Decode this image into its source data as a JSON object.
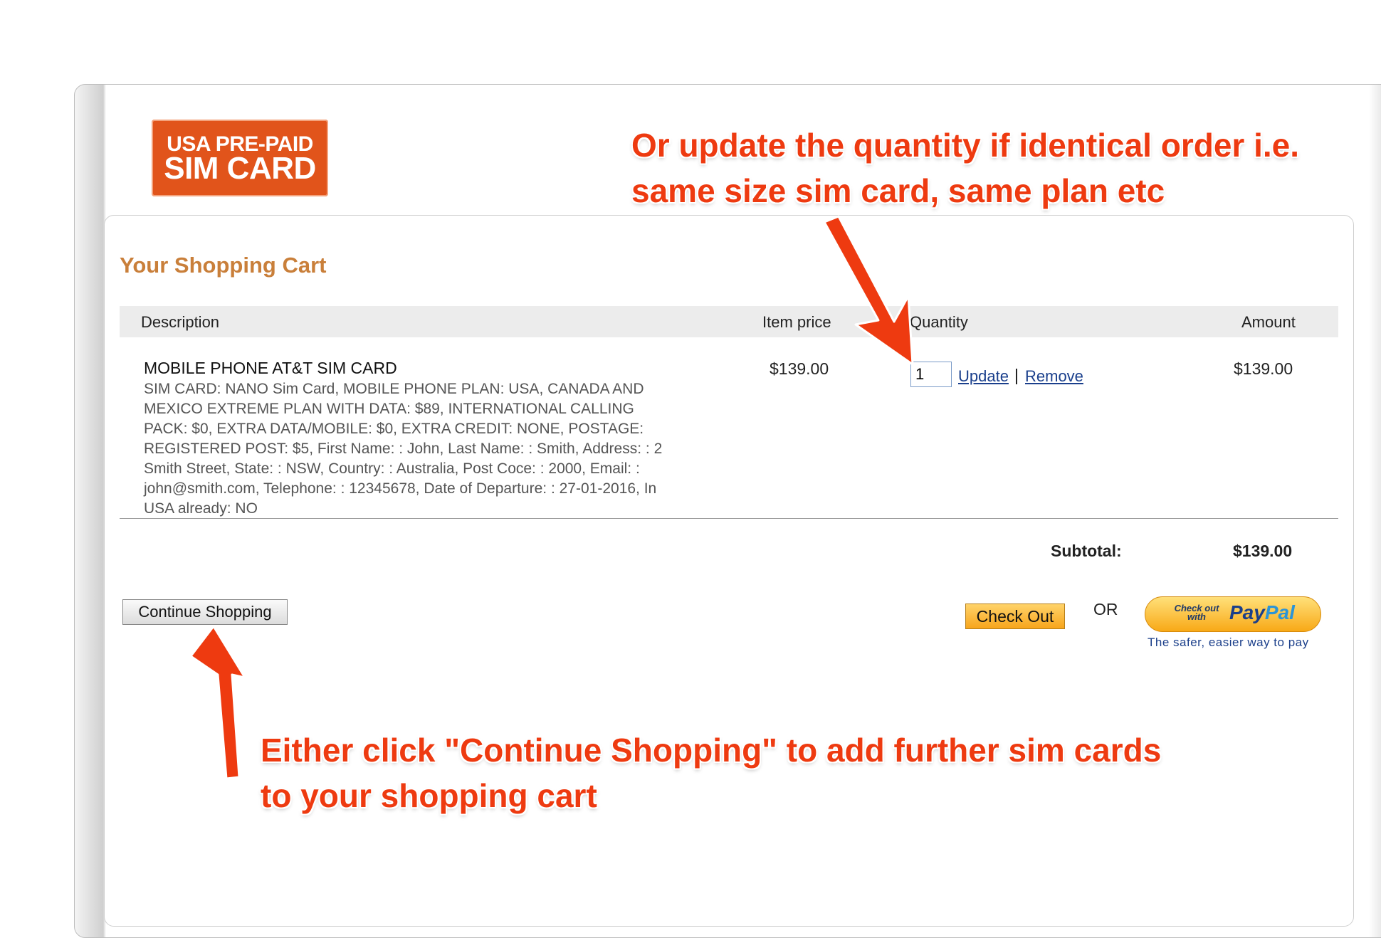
{
  "logo": {
    "line1": "USA PRE-PAID",
    "line2": "SIM CARD"
  },
  "cart": {
    "title": "Your Shopping Cart",
    "columns": {
      "description": "Description",
      "item_price": "Item price",
      "quantity": "Quantity",
      "amount": "Amount"
    },
    "items": [
      {
        "name": "MOBILE PHONE AT&T SIM CARD",
        "details": "SIM CARD: NANO Sim Card, MOBILE PHONE PLAN: USA, CANADA AND MEXICO EXTREME PLAN WITH DATA: $89, INTERNATIONAL CALLING PACK: $0, EXTRA DATA/MOBILE: $0, EXTRA CREDIT: NONE, POSTAGE: REGISTERED POST: $5, First Name: : John, Last Name: : Smith, Address: : 2 Smith Street, State: : NSW, Country: : Australia, Post Coce: : 2000, Email: : john@smith.com, Telephone: : 12345678, Date of Departure: : 27-01-2016, In USA already: NO",
        "item_price": "$139.00",
        "quantity": "1",
        "update_label": "Update",
        "separator": "|",
        "remove_label": "Remove",
        "amount": "$139.00"
      }
    ],
    "subtotal_label": "Subtotal:",
    "subtotal_value": "$139.00"
  },
  "actions": {
    "continue_label": "Continue Shopping",
    "checkout_label": "Check Out",
    "or_label": "OR",
    "paypal_small": "Check out with",
    "paypal_pay": "Pay",
    "paypal_pal": "Pal",
    "paypal_tagline": "The safer, easier way to pay"
  },
  "annotations": {
    "top_line1": "Or update the quantity if identical order i.e.",
    "top_line2": "same size sim card, same plan etc",
    "bottom_line1": "Either  click \"Continue Shopping\" to add further sim cards",
    "bottom_line2": "to your shopping cart"
  },
  "colors": {
    "brand_orange": "#e1541b",
    "title_brown": "#c97f3a",
    "annotation_red": "#ee3a10",
    "link_blue": "#1a3f8c"
  }
}
